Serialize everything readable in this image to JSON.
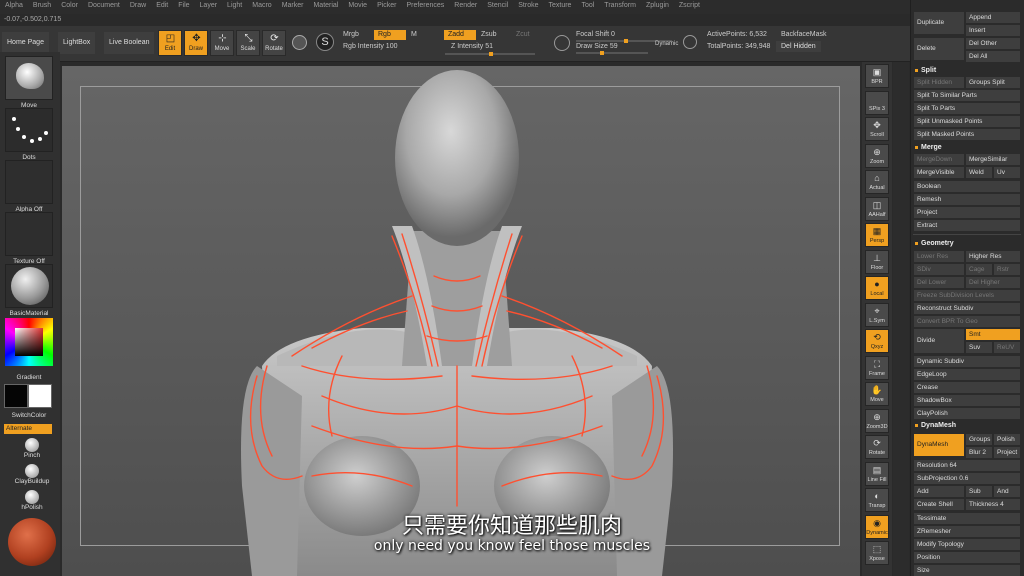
{
  "menu": [
    "Alpha",
    "Brush",
    "Color",
    "Document",
    "Draw",
    "Edit",
    "File",
    "Layer",
    "Light",
    "Macro",
    "Marker",
    "Material",
    "Movie",
    "Picker",
    "Preferences",
    "Render",
    "Stencil",
    "Stroke",
    "Texture",
    "Tool",
    "Transform",
    "Zplugin",
    "Zscript"
  ],
  "coords": "-0.07,-0.502,0.715",
  "toolbar": {
    "home_page": "Home Page",
    "lightbox": "LightBox",
    "live_boolean": "Live Boolean",
    "edit": "Edit",
    "draw": "Draw",
    "move": "Move",
    "scale": "Scale",
    "rotate": "Rotate",
    "mrgb": "Mrgb",
    "rgb": "Rgb",
    "m": "M",
    "rgb_intensity": "Rgb Intensity 100",
    "zadd": "Zadd",
    "zsub": "Zsub",
    "zcut": "Zcut",
    "z_intensity": "Z Intensity 51",
    "focal_shift": "Focal Shift 0",
    "draw_size": "Draw Size 59",
    "dynamic": "Dynamic",
    "active_points": "ActivePoints: 6,532",
    "total_points": "TotalPoints: 349,948",
    "backface_mask": "BackfaceMask",
    "del_hidden": "Del Hidden"
  },
  "left_shelf": {
    "move": "Move",
    "dots": "Dots",
    "alpha_off": "Alpha Off",
    "texture_off": "Texture Off",
    "basic_material": "BasicMaterial",
    "gradient": "Gradient",
    "switch_color": "SwitchColor",
    "alternate": "Alternate",
    "pinch": "Pinch",
    "clay_buildup": "ClayBuildup",
    "hpolish": "hPolish"
  },
  "right_shelf": {
    "bpr": "BPR",
    "spix": "SPix 3",
    "scroll": "Scroll",
    "zoom": "Zoom",
    "actual": "Actual",
    "aahalf": "AAHalf",
    "persp": "Persp",
    "floor": "Floor",
    "local": "Local",
    "lsym": "L.Sym",
    "xyz": "Qxyz",
    "frame": "Frame",
    "move": "Move",
    "zoom3d": "Zoom3D",
    "rotate": "Rotate",
    "linefill": "Line Fill",
    "polyf": "PolyF",
    "transp": "Transp",
    "dynamic": "Dynamic",
    "solo": "Solo",
    "xpose": "Xpose"
  },
  "palette": {
    "duplicate": "Duplicate",
    "append": "Append",
    "insert": "Insert",
    "delete": "Delete",
    "del_other": "Del Other",
    "del_all": "Del All",
    "split_header": "Split",
    "split_hidden": "Split Hidden",
    "groups_split": "Groups Split",
    "split_similar": "Split To Similar Parts",
    "split_parts": "Split To Parts",
    "split_unmasked": "Split Unmasked Points",
    "split_masked": "Split Masked Points",
    "merge_header": "Merge",
    "merge_down": "MergeDown",
    "merge_similar": "MergeSimilar",
    "merge_visible": "MergeVisible",
    "weld": "Weld",
    "uv": "Uv",
    "boolean": "Boolean",
    "remesh": "Remesh",
    "project": "Project",
    "extract": "Extract",
    "geometry_header": "Geometry",
    "lower_res": "Lower Res",
    "higher_res": "Higher Res",
    "sdiv": "SDiv",
    "cage": "Cage",
    "rstr": "Rstr",
    "del_lower": "Del Lower",
    "del_higher": "Del Higher",
    "freeze_subdiv": "Freeze SubDivision Levels",
    "reconstruct_subdiv": "Reconstruct Subdiv",
    "convert_bpr": "Convert BPR To Geo",
    "divide": "Divide",
    "smt": "Smt",
    "suv": "Suv",
    "reuv": "ReUV",
    "dynamic_subdiv": "Dynamic Subdiv",
    "edgeloop": "EdgeLoop",
    "crease": "Crease",
    "shadowbox": "ShadowBox",
    "claypolish": "ClayPolish",
    "dynamesh_header": "DynaMesh",
    "dynamesh": "DynaMesh",
    "groups": "Groups",
    "polish": "Polish",
    "blur": "Blur 2",
    "project2": "Project",
    "resolution": "Resolution 64",
    "subprojection": "SubProjection 0.6",
    "add": "Add",
    "sub": "Sub",
    "and": "And",
    "create_shell": "Create Shell",
    "thickness": "Thickness 4",
    "tessimate": "Tessimate",
    "zremesher": "ZRemesher",
    "modify_topology": "Modify Topology",
    "position": "Position",
    "size": "Size"
  },
  "subtitle": {
    "chinese": "只需要你知道那些肌肉",
    "english": "only need you know feel those muscles"
  },
  "colors": {
    "accent": "#f0a020",
    "stroke": "#ff5030"
  }
}
